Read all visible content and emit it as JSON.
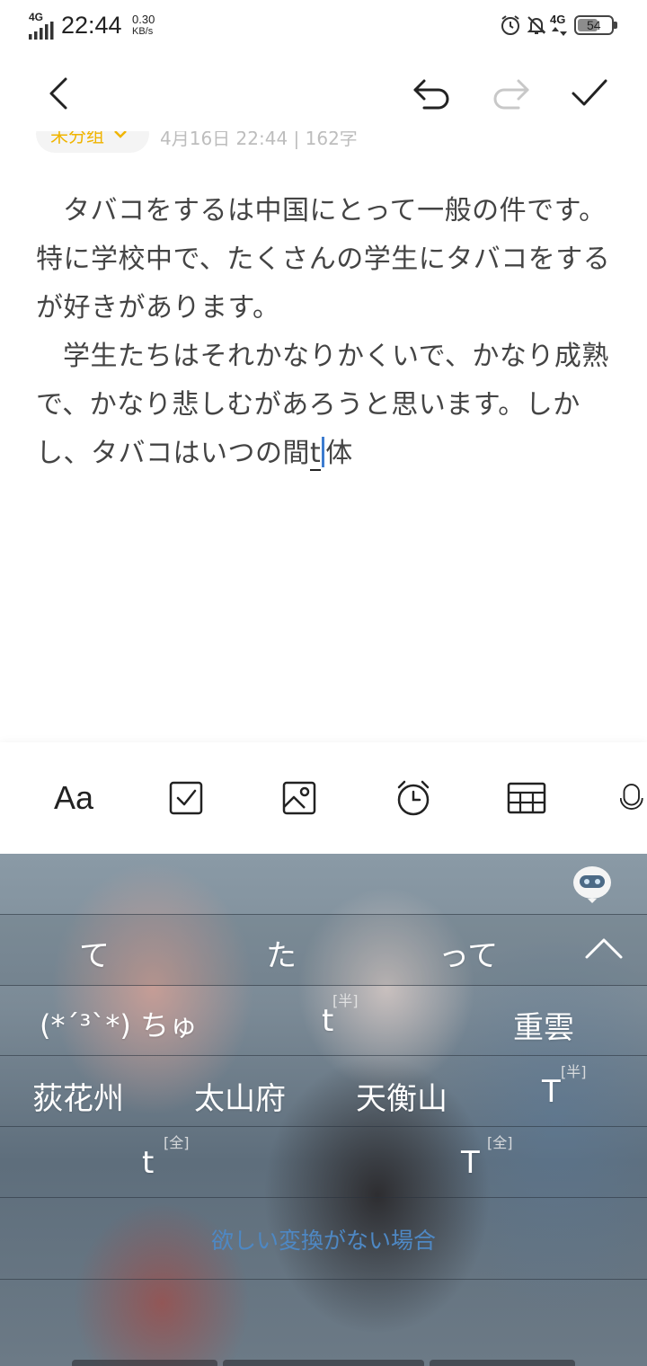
{
  "status_bar": {
    "network": "4G",
    "time": "22:44",
    "speed_value": "0.30",
    "speed_unit": "KB/s",
    "network_right": "4G",
    "battery": "54"
  },
  "top_bar": {
    "back_icon": "chevron-left-icon",
    "undo_icon": "undo-icon",
    "redo_icon": "redo-icon",
    "confirm_icon": "check-icon"
  },
  "meta": {
    "folder_label": "未分组",
    "info_text": "4月16日 22:44 | 162字"
  },
  "note": {
    "paragraph_1": "タバコをするは中国にとって一般の件です。特に学校中で、たくさんの学生にタバコをするが好きがあります。",
    "paragraph_2_prefix": "学生たちはそれかなりかくいで、かなり成熟で、かなり悲しむがあろうと思います。しかし、タバコはいつの間",
    "composing_text": "t",
    "paragraph_2_suffix": "体"
  },
  "toolbar": {
    "text_style_label": "Aa",
    "items": [
      "text-style",
      "checkbox-icon",
      "image-icon",
      "alarm-clock-icon",
      "table-icon",
      "microphone-icon"
    ]
  },
  "keyboard": {
    "assistant_icon": "robot-icon",
    "candidates_row1": [
      "て",
      "た",
      "って"
    ],
    "collapse_icon": "chevron-up-icon",
    "candidates_row2": [
      "(*´³`*) ちゅ",
      "t",
      "重雲"
    ],
    "row2_tag": "[半]",
    "candidates_row3": [
      "荻花州",
      "太山府",
      "天衡山",
      "T"
    ],
    "row3_tag": "[半]",
    "candidates_row4": [
      "t",
      "T"
    ],
    "row4_tags": [
      "[全]",
      "[全]"
    ],
    "no_conversion_link": "欲しい変換がない場合"
  }
}
